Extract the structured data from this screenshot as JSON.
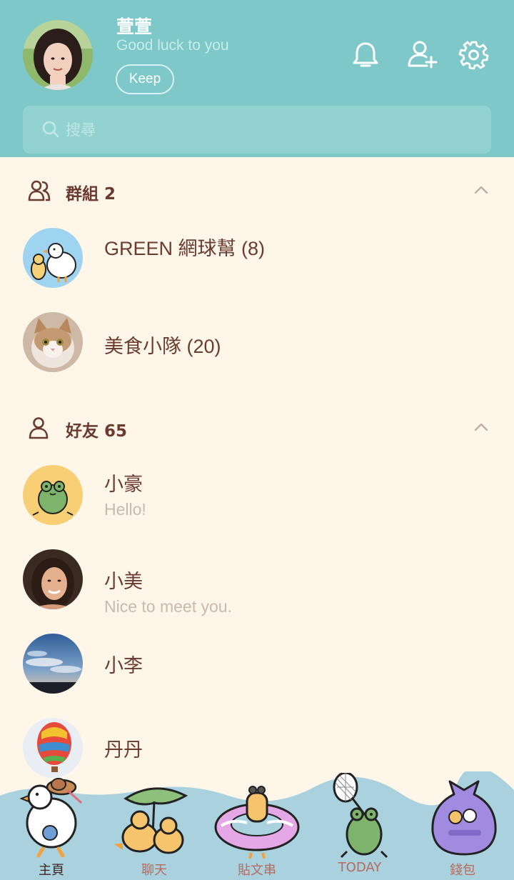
{
  "profile": {
    "name": "萱萱",
    "status": "Good luck to you",
    "keep_label": "Keep",
    "avatar": "profile-photo"
  },
  "header_icons": [
    "bell-icon",
    "add-friend-icon",
    "settings-icon"
  ],
  "search": {
    "placeholder": "搜尋"
  },
  "groups": {
    "title": "群組 2",
    "items": [
      {
        "name": "GREEN 網球幫 (8)",
        "avatar": "duck-illustration"
      },
      {
        "name": "美食小隊 (20)",
        "avatar": "cat-photo"
      }
    ]
  },
  "friends": {
    "title": "好友 65",
    "items": [
      {
        "name": "小豪",
        "message": "Hello!",
        "avatar": "frog-illustration"
      },
      {
        "name": "小美",
        "message": "Nice to meet you.",
        "avatar": "woman-photo"
      },
      {
        "name": "小李",
        "message": "",
        "avatar": "sky-photo"
      },
      {
        "name": "丹丹",
        "message": "",
        "avatar": "balloon-photo"
      }
    ]
  },
  "tabs": [
    {
      "label": "主頁",
      "icon": "duck-hat-icon",
      "active": true
    },
    {
      "label": "聊天",
      "icon": "ducks-leaf-icon",
      "active": false
    },
    {
      "label": "貼文串",
      "icon": "duck-float-icon",
      "active": false
    },
    {
      "label": "TODAY",
      "icon": "frog-net-icon",
      "active": false
    },
    {
      "label": "錢包",
      "icon": "food-bag-icon",
      "active": false
    }
  ],
  "colors": {
    "header": "#7ec8c9",
    "background": "#fdf6e9",
    "text": "#6b3a30",
    "subtext": "#c9b9ad",
    "tabbar": "#a9d1de"
  }
}
